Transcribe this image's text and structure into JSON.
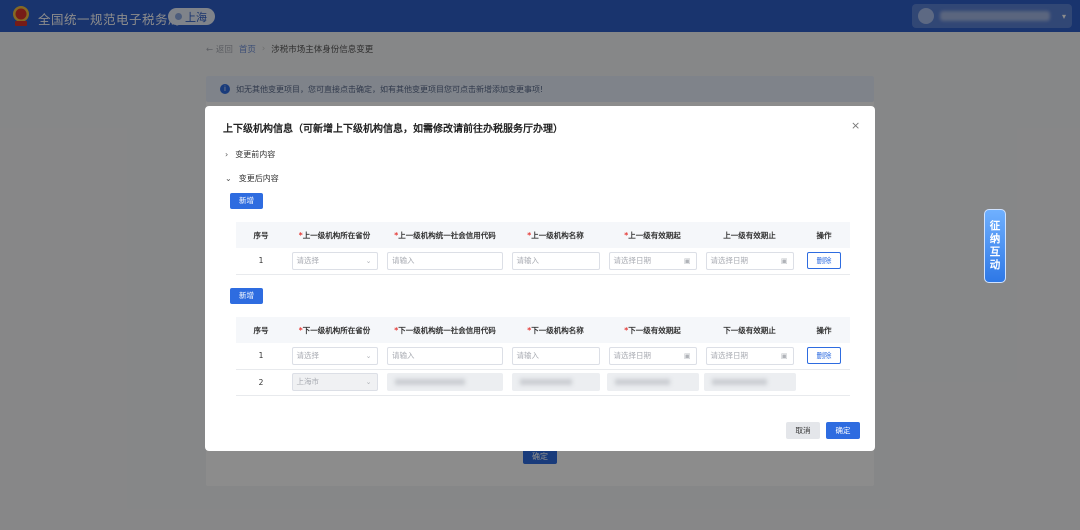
{
  "header": {
    "title": "全国统一规范电子税务局",
    "region": "上海",
    "user_caret": "▾",
    "emblem_icon": "tax-bureau-emblem",
    "brand_color": "#2e5fc8"
  },
  "breadcrumb": {
    "back": "← 返回",
    "home": "首页",
    "separator": "›",
    "current": "涉税市场主体身份信息变更"
  },
  "notice": {
    "icon_text": "i",
    "text": "如无其他变更项目，您可直接点击确定，如有其他变更项目您可点击新增添加变更事项!"
  },
  "page_confirm": "确定",
  "side_float": [
    "征",
    "纳",
    "互",
    "动"
  ],
  "dialog": {
    "title": "上下级机构信息（可新增上下级机构信息，如需修改请前往办税服务厅办理）",
    "close": "×",
    "before_toggle": {
      "arrow": "›",
      "label": "变更前内容"
    },
    "after_toggle": {
      "arrow": "⌄",
      "label": "变更后内容"
    },
    "add_label": "新增",
    "required_mark": "*",
    "upper_table": {
      "headers": [
        {
          "label": "序号",
          "required": false
        },
        {
          "label": "上一级机构所在省份",
          "required": true
        },
        {
          "label": "上一级机构统一社会信用代码",
          "required": true
        },
        {
          "label": "上一级机构名称",
          "required": true
        },
        {
          "label": "上一级有效期起",
          "required": true
        },
        {
          "label": "上一级有效期止",
          "required": false
        },
        {
          "label": "操作",
          "required": false
        }
      ],
      "rows": [
        {
          "index": "1",
          "province": "请选择",
          "code": "请输入",
          "name": "请输入",
          "start": "请选择日期",
          "end": "请选择日期",
          "action": "删除"
        }
      ]
    },
    "lower_table": {
      "headers": [
        {
          "label": "序号",
          "required": false
        },
        {
          "label": "下一级机构所在省份",
          "required": true
        },
        {
          "label": "下一级机构统一社会信用代码",
          "required": true
        },
        {
          "label": "下一级机构名称",
          "required": true
        },
        {
          "label": "下一级有效期起",
          "required": true
        },
        {
          "label": "下一级有效期止",
          "required": false
        },
        {
          "label": "操作",
          "required": false
        }
      ],
      "rows": [
        {
          "index": "1",
          "province": "请选择",
          "code": "请输入",
          "name": "请输入",
          "start": "请选择日期",
          "end": "请选择日期",
          "action": "删除"
        },
        {
          "index": "2",
          "province": "上海市"
        }
      ]
    },
    "cancel_label": "取消",
    "ok_label": "确定"
  }
}
